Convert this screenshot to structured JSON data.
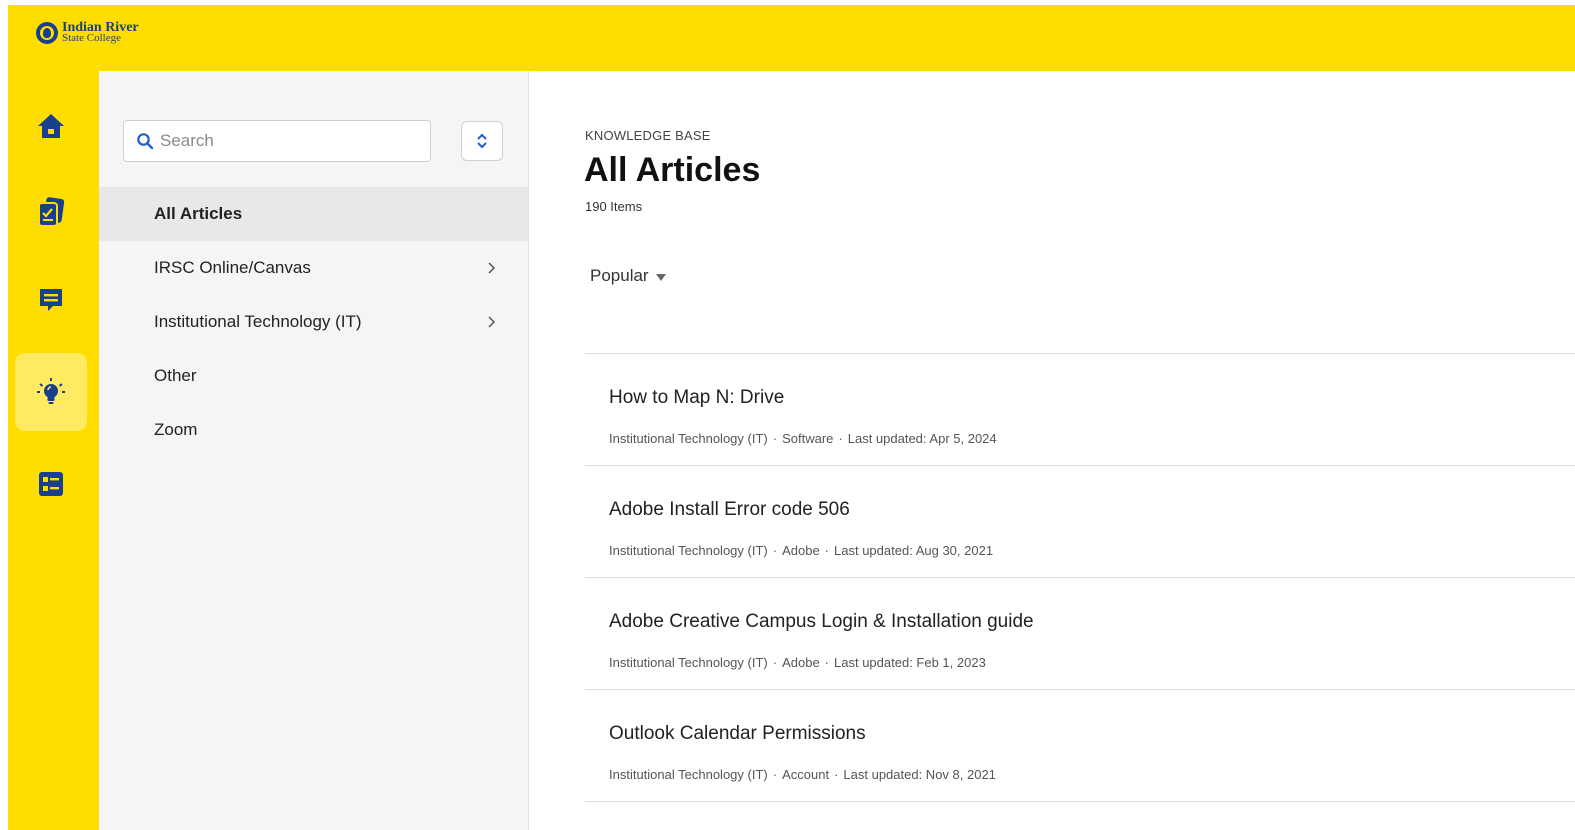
{
  "brand": {
    "line1": "Indian River",
    "line2": "State College",
    "color": "#ffdd00",
    "accent": "#1a3f8b"
  },
  "rail": {
    "items": [
      {
        "name": "home",
        "icon": "home-icon"
      },
      {
        "name": "forms",
        "icon": "checklist-cards-icon"
      },
      {
        "name": "messages",
        "icon": "chat-icon"
      },
      {
        "name": "knowledge-base",
        "icon": "lightbulb-icon",
        "active": true
      },
      {
        "name": "catalog",
        "icon": "list-grid-icon"
      }
    ]
  },
  "sidebar": {
    "search_placeholder": "Search",
    "items": [
      {
        "label": "All Articles",
        "active": true,
        "has_children": false
      },
      {
        "label": "IRSC Online/Canvas",
        "active": false,
        "has_children": true
      },
      {
        "label": "Institutional Technology (IT)",
        "active": false,
        "has_children": true
      },
      {
        "label": "Other",
        "active": false,
        "has_children": false
      },
      {
        "label": "Zoom",
        "active": false,
        "has_children": false
      }
    ]
  },
  "main": {
    "eyebrow": "KNOWLEDGE BASE",
    "title": "All Articles",
    "count": "190 Items",
    "sort_label": "Popular",
    "articles": [
      {
        "title": "How to Map N: Drive",
        "category": "Institutional Technology (IT)",
        "subcategory": "Software",
        "updated": "Last updated: Apr 5, 2024"
      },
      {
        "title": "Adobe Install Error code 506",
        "category": "Institutional Technology (IT)",
        "subcategory": "Adobe",
        "updated": "Last updated: Aug 30, 2021"
      },
      {
        "title": "Adobe Creative Campus Login & Installation guide",
        "category": "Institutional Technology (IT)",
        "subcategory": "Adobe",
        "updated": "Last updated: Feb 1, 2023"
      },
      {
        "title": "Outlook Calendar Permissions",
        "category": "Institutional Technology (IT)",
        "subcategory": "Account",
        "updated": "Last updated: Nov 8, 2021"
      }
    ],
    "separator": "·"
  }
}
